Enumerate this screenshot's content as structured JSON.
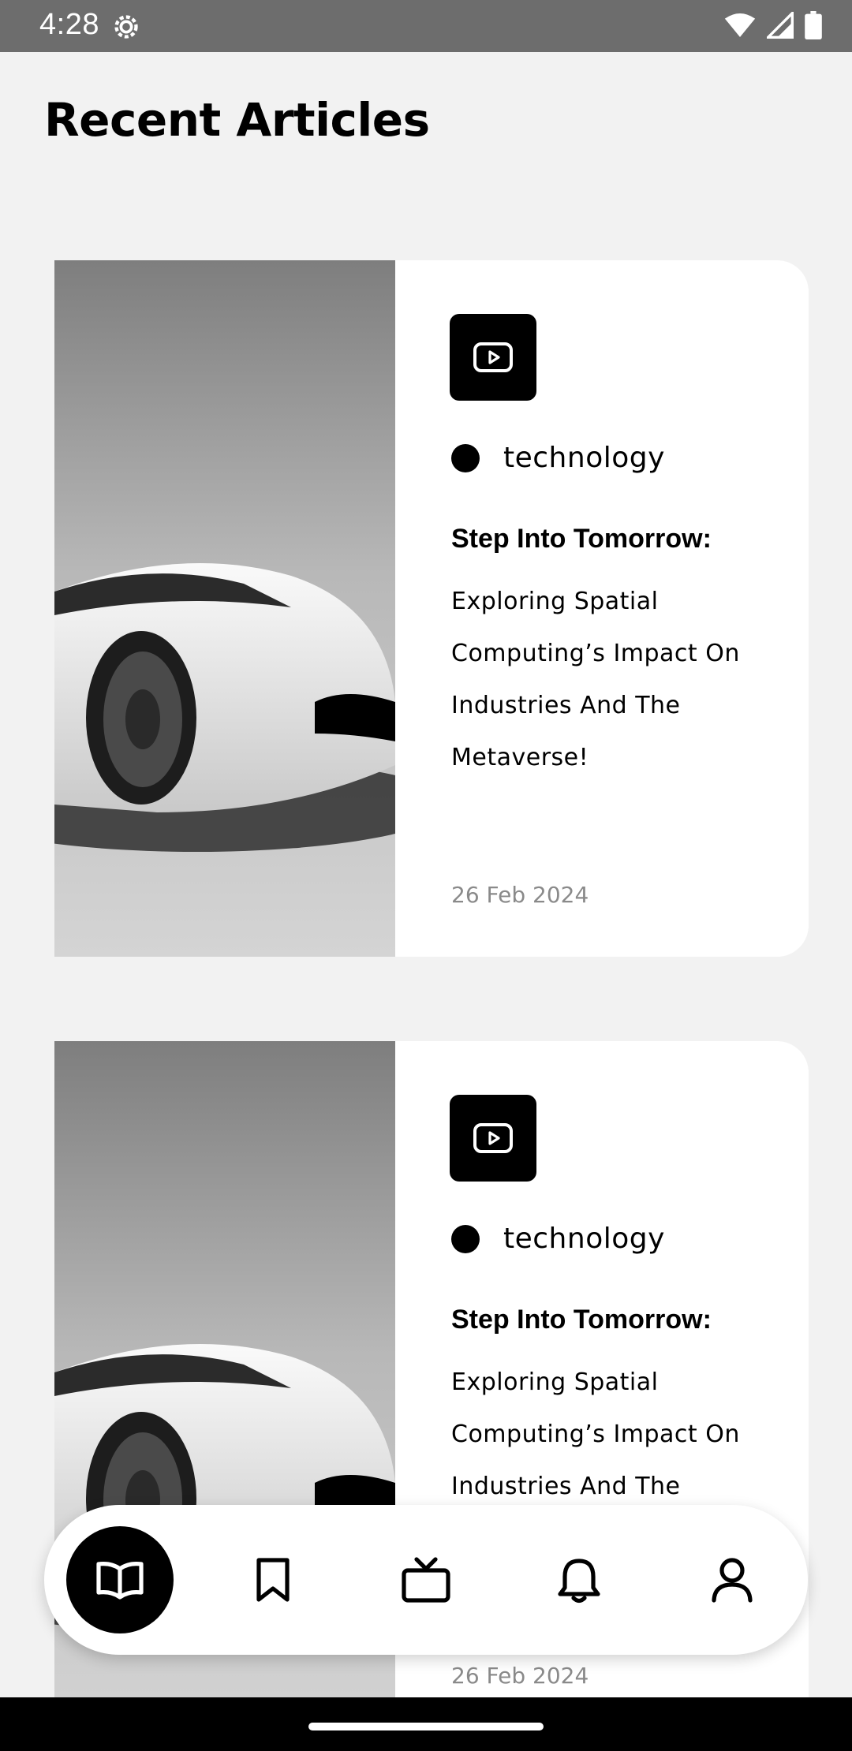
{
  "status_bar": {
    "time": "4:28",
    "icons": [
      "gear-icon",
      "wifi-icon",
      "signal-icon",
      "battery-icon"
    ]
  },
  "page": {
    "title": "Recent Articles"
  },
  "articles": [
    {
      "category": "technology",
      "title": "Step Into Tomorrow:",
      "subtitle": "Exploring Spatial Computing’s Impact On Industries And The Metaverse!",
      "date": "26 Feb 2024"
    },
    {
      "category": "technology",
      "title": "Step Into Tomorrow:",
      "subtitle": "Exploring Spatial Computing’s Impact On Industries And The Metaverse!",
      "date": "26 Feb 2024"
    }
  ],
  "bottom_nav": {
    "items": [
      {
        "icon": "book-open-icon",
        "active": true
      },
      {
        "icon": "bookmark-icon",
        "active": false
      },
      {
        "icon": "tv-icon",
        "active": false
      },
      {
        "icon": "bell-icon",
        "active": false
      },
      {
        "icon": "user-icon",
        "active": false
      }
    ]
  },
  "colors": {
    "background": "#f2f2f2",
    "status_bar": "#6d6d6d",
    "card": "#ffffff",
    "accent": "#000000",
    "date_text": "#8a8a8a"
  }
}
